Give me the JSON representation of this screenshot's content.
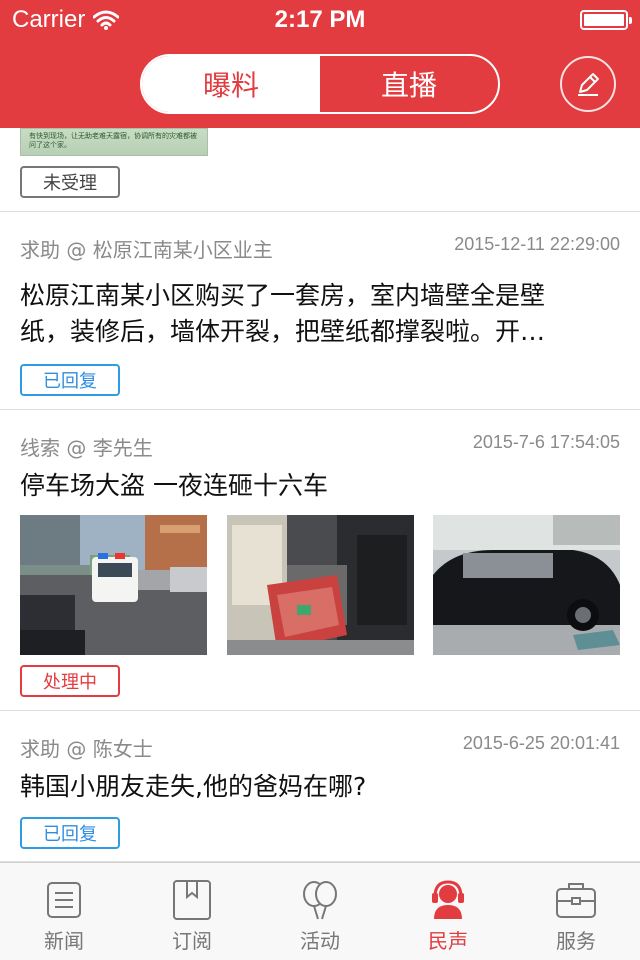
{
  "status_bar": {
    "carrier": "Carrier",
    "time": "2:17 PM"
  },
  "header": {
    "segments": [
      {
        "label": "曝料",
        "active": true
      },
      {
        "label": "直播",
        "active": false
      }
    ],
    "edit_icon": "pencil-icon"
  },
  "partial_item": {
    "image_text": "有快到现场，让无助老难天露宿，协调所有的灾难都被问了这个家。",
    "status": "未受理"
  },
  "feed": [
    {
      "category": "求助 @ 松原江南某小区业主",
      "time": "2015-12-11 22:29:00",
      "title_line1": "松原江南某小区购买了一套房，室内墙壁全是壁",
      "title_line2": "纸，装修后，墙体开裂，把壁纸都撑裂啦。开…",
      "status": "已回复"
    },
    {
      "category": "线索 @ 李先生",
      "time": "2015-7-6 17:54:05",
      "title": "停车场大盗 一夜连砸十六车",
      "status": "处理中"
    },
    {
      "category": "求助 @ 陈女士",
      "time": "2015-6-25 20:01:41",
      "title": "韩国小朋友走失,他的爸妈在哪?",
      "status": "已回复"
    }
  ],
  "tabbar": [
    {
      "label": "新闻",
      "icon": "newspaper-icon",
      "active": false
    },
    {
      "label": "订阅",
      "icon": "bookmark-icon",
      "active": false
    },
    {
      "label": "活动",
      "icon": "balloons-icon",
      "active": false
    },
    {
      "label": "民声",
      "icon": "headset-user-icon",
      "active": true
    },
    {
      "label": "服务",
      "icon": "briefcase-icon",
      "active": false
    }
  ],
  "colors": {
    "brand_red": "#e23b40",
    "reply_blue": "#2f8de0",
    "muted_gray": "#8a8a8a"
  }
}
